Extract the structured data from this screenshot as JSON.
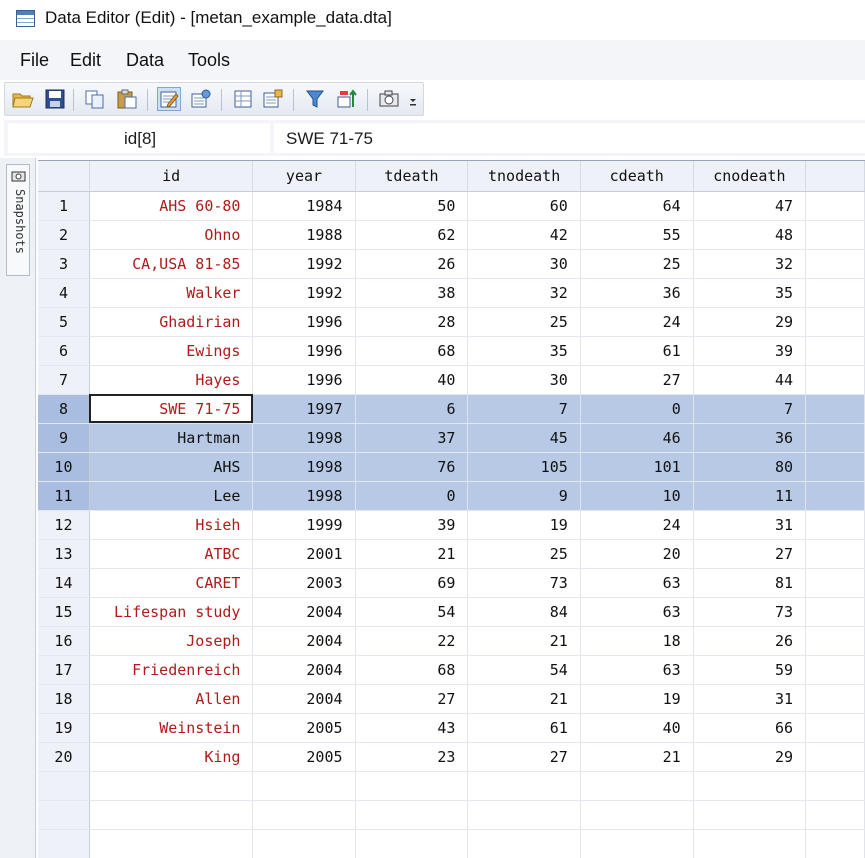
{
  "window": {
    "title": "Data Editor (Edit) - [metan_example_data.dta]"
  },
  "menu": {
    "file": "File",
    "edit": "Edit",
    "data": "Data",
    "tools": "Tools"
  },
  "cellbar": {
    "varname": "id[8]",
    "value": "SWE 71-75"
  },
  "snapshots": {
    "label": "Snapshots"
  },
  "grid": {
    "columns": [
      "id",
      "year",
      "tdeath",
      "tnodeath",
      "cdeath",
      "cnodeath"
    ],
    "rows": [
      [
        "AHS 60-80",
        "1984",
        "50",
        "60",
        "64",
        "47"
      ],
      [
        "Ohno",
        "1988",
        "62",
        "42",
        "55",
        "48"
      ],
      [
        "CA,USA 81-85",
        "1992",
        "26",
        "30",
        "25",
        "32"
      ],
      [
        "Walker",
        "1992",
        "38",
        "32",
        "36",
        "35"
      ],
      [
        "Ghadirian",
        "1996",
        "28",
        "25",
        "24",
        "29"
      ],
      [
        "Ewings",
        "1996",
        "68",
        "35",
        "61",
        "39"
      ],
      [
        "Hayes",
        "1996",
        "40",
        "30",
        "27",
        "44"
      ],
      [
        "SWE 71-75",
        "1997",
        "6",
        "7",
        "0",
        "7"
      ],
      [
        "Hartman",
        "1998",
        "37",
        "45",
        "46",
        "36"
      ],
      [
        "AHS",
        "1998",
        "76",
        "105",
        "101",
        "80"
      ],
      [
        "Lee",
        "1998",
        "0",
        "9",
        "10",
        "11"
      ],
      [
        "Hsieh",
        "1999",
        "39",
        "19",
        "24",
        "31"
      ],
      [
        "ATBC",
        "2001",
        "21",
        "25",
        "20",
        "27"
      ],
      [
        "CARET",
        "2003",
        "69",
        "73",
        "63",
        "81"
      ],
      [
        "Lifespan study",
        "2004",
        "54",
        "84",
        "63",
        "73"
      ],
      [
        "Joseph",
        "2004",
        "22",
        "21",
        "18",
        "26"
      ],
      [
        "Friedenreich",
        "2004",
        "68",
        "54",
        "63",
        "59"
      ],
      [
        "Allen",
        "2004",
        "27",
        "21",
        "19",
        "31"
      ],
      [
        "Weinstein",
        "2005",
        "43",
        "61",
        "40",
        "66"
      ],
      [
        "King",
        "2005",
        "23",
        "27",
        "21",
        "29"
      ]
    ],
    "selected_rows": [
      8,
      9,
      10,
      11
    ],
    "current_cell": {
      "row": 8,
      "column": "id"
    },
    "empty_rows": 3
  },
  "toolbar": {
    "buttons": [
      "open-icon",
      "save-icon",
      "copy-icon",
      "paste-icon",
      "edit-mode-icon",
      "variables-manager-icon",
      "data-editor-browse-icon",
      "properties-icon",
      "filter-icon",
      "sort-icon",
      "snapshot-icon",
      "toolbar-overflow-icon"
    ]
  },
  "colors": {
    "string_text": "#b01a1a",
    "selection": "#b8c9e6",
    "header": "#eef2f8"
  }
}
